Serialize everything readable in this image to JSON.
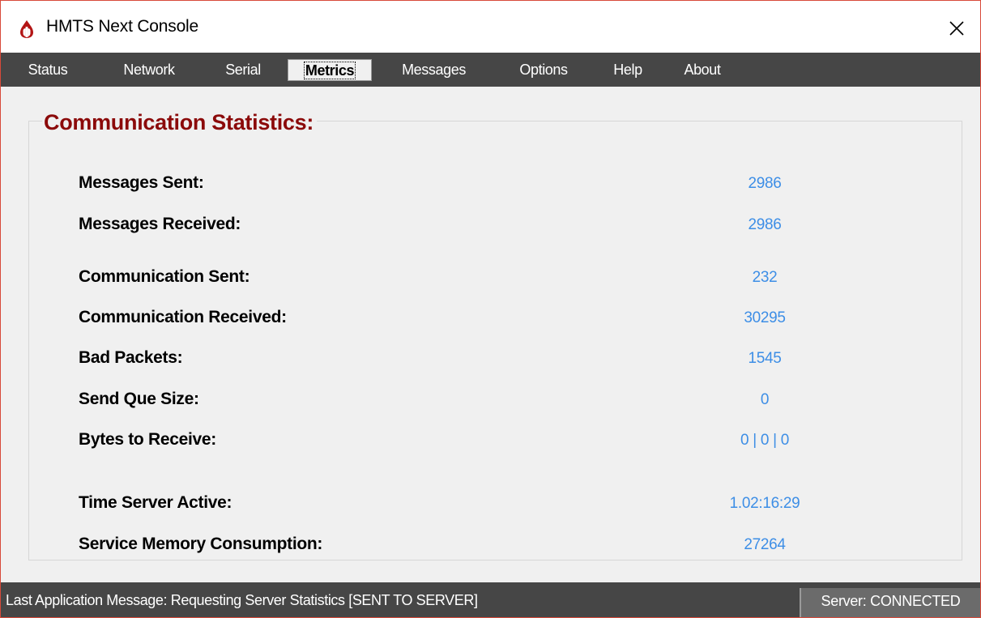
{
  "window": {
    "title": "HMTS Next Console",
    "close_icon": "close-icon",
    "app_icon": "hmts-logo-icon"
  },
  "menu": {
    "items": [
      {
        "label": "Status",
        "active": false
      },
      {
        "label": "Network",
        "active": false
      },
      {
        "label": "Serial",
        "active": false
      },
      {
        "label": "Metrics",
        "active": true
      },
      {
        "label": "Messages",
        "active": false
      },
      {
        "label": "Options",
        "active": false
      },
      {
        "label": "Help",
        "active": false
      },
      {
        "label": "About",
        "active": false
      }
    ]
  },
  "metrics": {
    "group_title": "Communication Statistics:",
    "stats": [
      {
        "label": "Messages Sent:",
        "value": "2986"
      },
      {
        "label": "Messages Received:",
        "value": "2986"
      },
      {
        "label": "Communication Sent:",
        "value": "232"
      },
      {
        "label": "Communication Received:",
        "value": "30295"
      },
      {
        "label": "Bad Packets:",
        "value": "1545"
      },
      {
        "label": "Send Que Size:",
        "value": "0"
      },
      {
        "label": "Bytes to Receive:",
        "value": "0 | 0 | 0"
      },
      {
        "label": "Time Server Active:",
        "value": "1.02:16:29"
      },
      {
        "label": "Service Memory Consumption:",
        "value": "27264"
      }
    ]
  },
  "statusbar": {
    "message": "Last Application Message:  Requesting Server Statistics [SENT TO SERVER]",
    "server_status": "Server:  CONNECTED"
  },
  "colors": {
    "menubar_bg": "#464646",
    "title_accent": "#8b0a0a",
    "value_text": "#3d8ee6",
    "window_border": "#d84a3a"
  }
}
